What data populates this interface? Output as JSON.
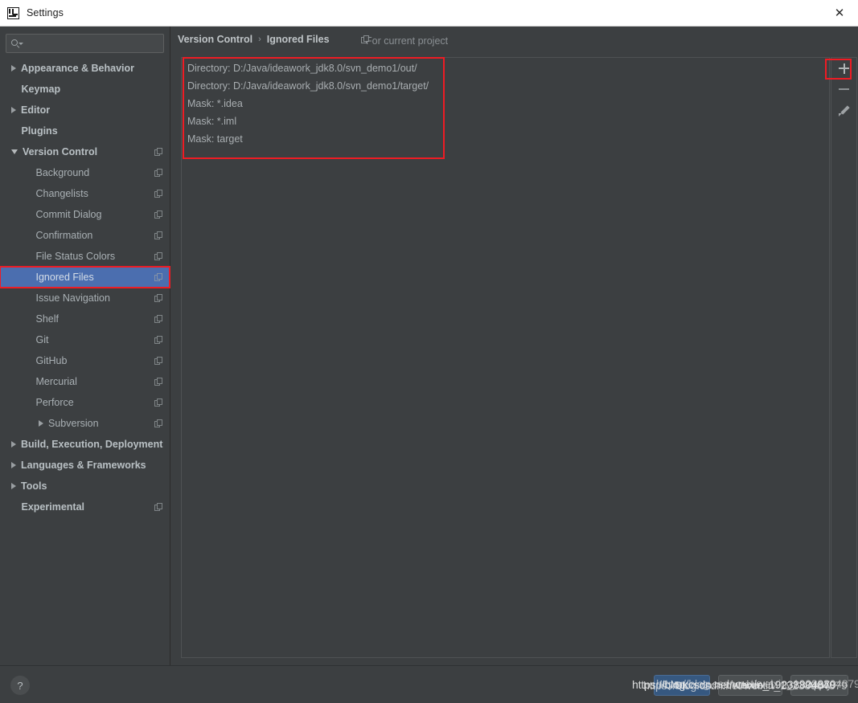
{
  "window": {
    "title": "Settings",
    "app_icon": "intellij-idea-logo",
    "close_label": "✕"
  },
  "sidebar": {
    "search": {
      "value": "",
      "placeholder": "",
      "icon": "search-icon"
    },
    "items": [
      {
        "label": "Appearance & Behavior",
        "indent": 0,
        "arrow": "right",
        "bold": true,
        "copy": false,
        "selected": false
      },
      {
        "label": "Keymap",
        "indent": 0,
        "arrow": "none",
        "bold": true,
        "copy": false,
        "selected": false
      },
      {
        "label": "Editor",
        "indent": 0,
        "arrow": "right",
        "bold": true,
        "copy": false,
        "selected": false
      },
      {
        "label": "Plugins",
        "indent": 0,
        "arrow": "none",
        "bold": true,
        "copy": false,
        "selected": false
      },
      {
        "label": "Version Control",
        "indent": 0,
        "arrow": "down",
        "bold": true,
        "copy": true,
        "selected": false
      },
      {
        "label": "Background",
        "indent": 1,
        "arrow": "none",
        "bold": false,
        "copy": true,
        "selected": false
      },
      {
        "label": "Changelists",
        "indent": 1,
        "arrow": "none",
        "bold": false,
        "copy": true,
        "selected": false
      },
      {
        "label": "Commit Dialog",
        "indent": 1,
        "arrow": "none",
        "bold": false,
        "copy": true,
        "selected": false
      },
      {
        "label": "Confirmation",
        "indent": 1,
        "arrow": "none",
        "bold": false,
        "copy": true,
        "selected": false
      },
      {
        "label": "File Status Colors",
        "indent": 1,
        "arrow": "none",
        "bold": false,
        "copy": true,
        "selected": false
      },
      {
        "label": "Ignored Files",
        "indent": 1,
        "arrow": "none",
        "bold": false,
        "copy": true,
        "selected": true
      },
      {
        "label": "Issue Navigation",
        "indent": 1,
        "arrow": "none",
        "bold": false,
        "copy": true,
        "selected": false
      },
      {
        "label": "Shelf",
        "indent": 1,
        "arrow": "none",
        "bold": false,
        "copy": true,
        "selected": false
      },
      {
        "label": "Git",
        "indent": 1,
        "arrow": "none",
        "bold": false,
        "copy": true,
        "selected": false
      },
      {
        "label": "GitHub",
        "indent": 1,
        "arrow": "none",
        "bold": false,
        "copy": true,
        "selected": false
      },
      {
        "label": "Mercurial",
        "indent": 1,
        "arrow": "none",
        "bold": false,
        "copy": true,
        "selected": false
      },
      {
        "label": "Perforce",
        "indent": 1,
        "arrow": "none",
        "bold": false,
        "copy": true,
        "selected": false
      },
      {
        "label": "Subversion",
        "indent": 2,
        "arrow": "right",
        "bold": false,
        "copy": true,
        "selected": false
      },
      {
        "label": "Build, Execution, Deployment",
        "indent": 0,
        "arrow": "right",
        "bold": true,
        "copy": false,
        "selected": false
      },
      {
        "label": "Languages & Frameworks",
        "indent": 0,
        "arrow": "right",
        "bold": true,
        "copy": false,
        "selected": false
      },
      {
        "label": "Tools",
        "indent": 0,
        "arrow": "right",
        "bold": true,
        "copy": false,
        "selected": false
      },
      {
        "label": "Experimental",
        "indent": 0,
        "arrow": "none",
        "bold": true,
        "copy": true,
        "selected": false
      }
    ]
  },
  "content": {
    "breadcrumb": {
      "parent": "Version Control",
      "separator": "›",
      "current": "Ignored Files"
    },
    "scope_label": "For current project",
    "scope_icon": "copy-icon",
    "ignored_files": [
      "Directory: D:/Java/ideawork_jdk8.0/svn_demo1/out/",
      "Directory: D:/Java/ideawork_jdk8.0/svn_demo1/target/",
      "Mask: *.idea",
      "Mask: *.iml",
      "Mask: target"
    ],
    "toolbar": [
      {
        "name": "add-button",
        "icon": "plus-icon",
        "highlighted": true
      },
      {
        "name": "remove-button",
        "icon": "minus-icon",
        "highlighted": false
      },
      {
        "name": "edit-button",
        "icon": "pencil-icon",
        "highlighted": false
      }
    ]
  },
  "footer": {
    "help_label": "?",
    "ok_label": "OK",
    "cancel_label": "Cancel",
    "apply_label": "Apply",
    "watermark": "https://blog.csdn.net/weixin_19238804879"
  },
  "colors": {
    "window_background": "#3c3f41",
    "titlebar_background": "#ffffff",
    "selection_blue": "#4b6eaf",
    "primary_button": "#365880",
    "highlight_red": "#ee1c24",
    "text_primary": "#bfc4c7",
    "text_secondary": "#a9aeb1"
  }
}
